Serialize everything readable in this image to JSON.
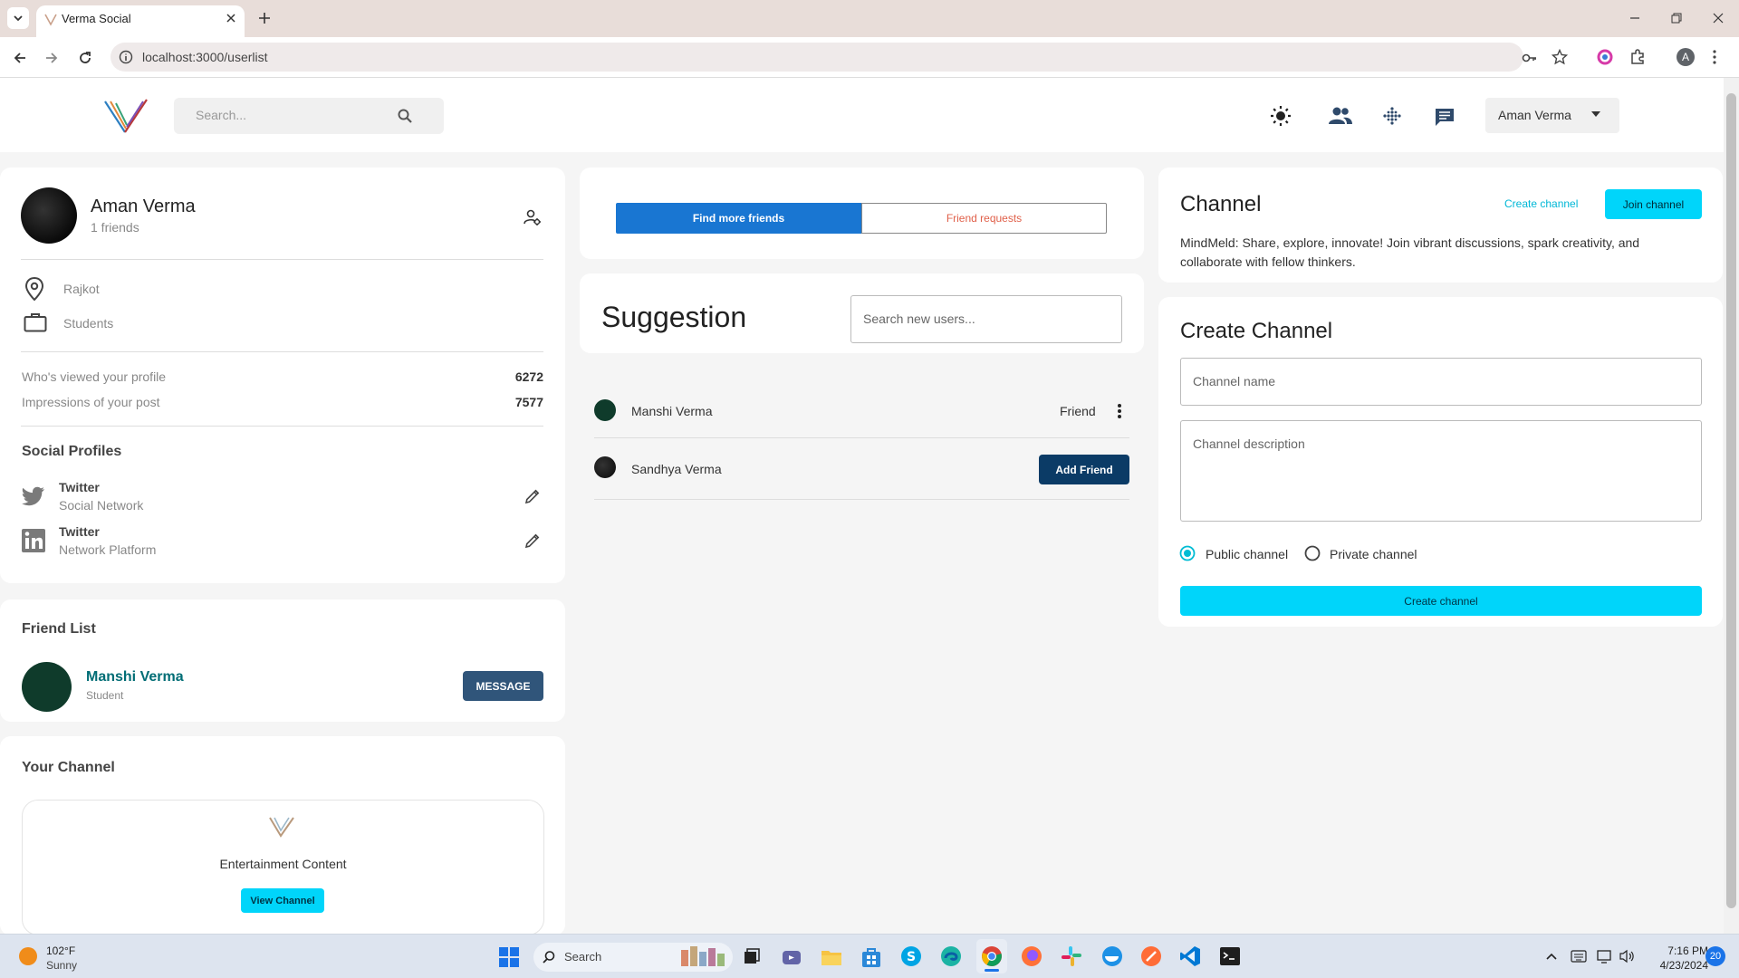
{
  "browser": {
    "tab_title": "Verma Social",
    "url": "localhost:3000/userlist",
    "profile_initial": "A"
  },
  "header": {
    "search_placeholder": "Search...",
    "user_name": "Aman Verma"
  },
  "profile": {
    "name": "Aman Verma",
    "friends_count": "1 friends",
    "location": "Rajkot",
    "occupation": "Students",
    "stats": [
      {
        "label": "Who's viewed your profile",
        "value": "6272"
      },
      {
        "label": "Impressions of your post",
        "value": "7577"
      }
    ],
    "social_title": "Social Profiles",
    "socials": [
      {
        "name": "Twitter",
        "type": "Social Network",
        "icon": "twitter-icon"
      },
      {
        "name": "Twitter",
        "type": "Network Platform",
        "icon": "linkedin-icon"
      }
    ]
  },
  "friend_list": {
    "title": "Friend List",
    "friend_name": "Manshi Verma",
    "friend_role": "Student",
    "message_label": "MESSAGE"
  },
  "your_channel": {
    "title": "Your Channel",
    "channel_name": "Entertainment Content",
    "view_label": "View Channel"
  },
  "friends_tabs": {
    "find": "Find more friends",
    "requests": "Friend requests"
  },
  "suggestion": {
    "title": "Suggestion",
    "search_placeholder": "Search new users...",
    "users": [
      {
        "name": "Manshi Verma",
        "status": "Friend"
      },
      {
        "name": "Sandhya Verma",
        "action": "Add Friend"
      }
    ]
  },
  "channel": {
    "title": "Channel",
    "create_link": "Create channel",
    "join_label": "Join channel",
    "description": "MindMeld: Share, explore, innovate! Join vibrant discussions, spark creativity, and collaborate with fellow thinkers."
  },
  "create_channel": {
    "title": "Create Channel",
    "name_placeholder": "Channel name",
    "description_placeholder": "Channel description",
    "public_label": "Public channel",
    "private_label": "Private channel",
    "selected": "public",
    "submit_label": "Create channel"
  },
  "taskbar": {
    "temperature": "102°F",
    "weather": "Sunny",
    "search_label": "Search",
    "time": "7:16 PM",
    "date": "4/23/2024",
    "notifications": "20"
  },
  "colors": {
    "primary_blue": "#1976d2",
    "dark_navy": "#0b3b66",
    "cyan": "#00d5fa",
    "teal_text": "#006d75",
    "message_btn": "#30557a",
    "friend_request_text": "#e0604a"
  }
}
